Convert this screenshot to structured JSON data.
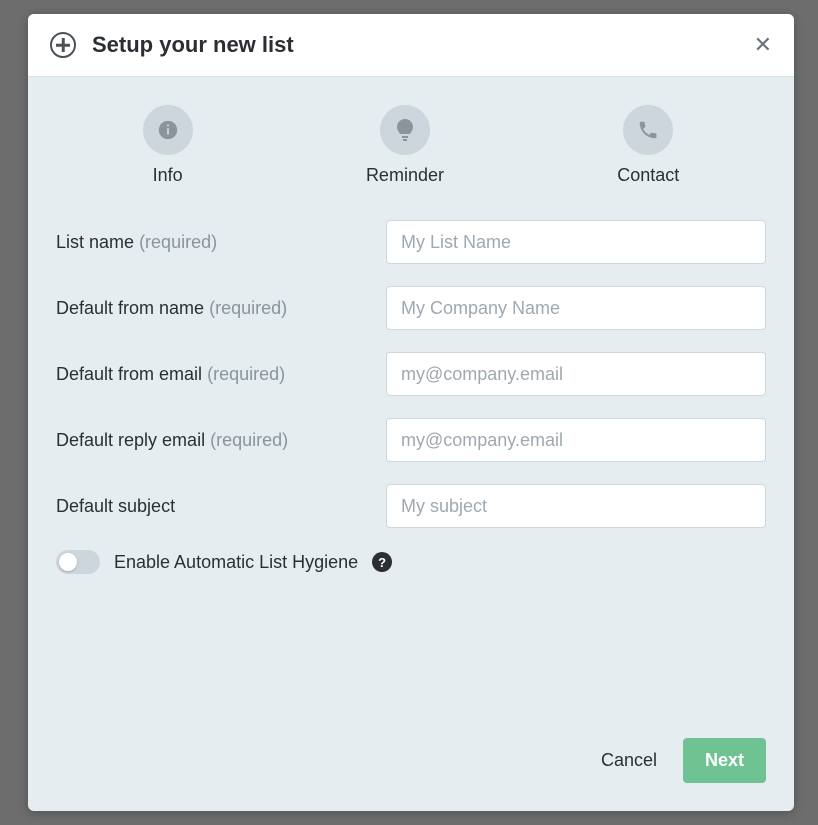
{
  "header": {
    "title": "Setup your new list",
    "close_glyph": "✕"
  },
  "steps": {
    "info": "Info",
    "reminder": "Reminder",
    "contact": "Contact"
  },
  "required_text": "(required)",
  "fields": {
    "list_name": {
      "label": "List name",
      "placeholder": "My List Name",
      "required": true
    },
    "from_name": {
      "label": "Default from name",
      "placeholder": "My Company Name",
      "required": true
    },
    "from_email": {
      "label": "Default from email",
      "placeholder": "my@company.email",
      "required": true
    },
    "reply_email": {
      "label": "Default reply email",
      "placeholder": "my@company.email",
      "required": true
    },
    "subject": {
      "label": "Default subject",
      "placeholder": "My subject",
      "required": false
    }
  },
  "hygiene": {
    "label": "Enable Automatic List Hygiene",
    "enabled": false,
    "help_glyph": "?"
  },
  "footer": {
    "cancel": "Cancel",
    "next": "Next"
  }
}
